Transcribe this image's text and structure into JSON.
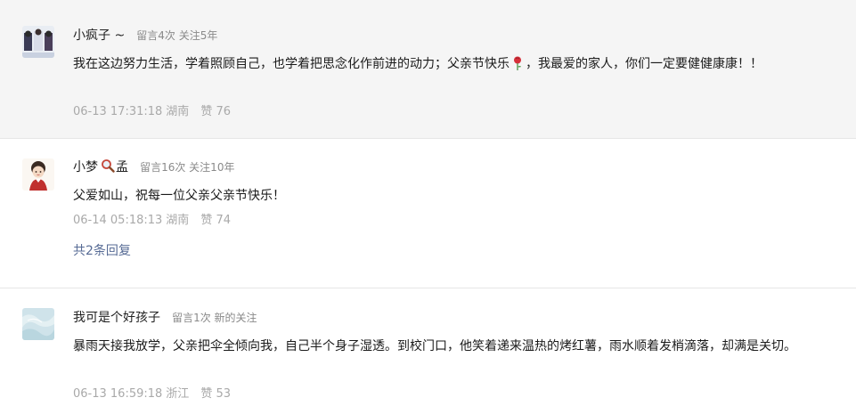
{
  "comments": [
    {
      "nickname": "小疯子 ~",
      "stats": "留言4次 关注5年",
      "content_a": "我在这边努力生活，学着照顾自己，也学着把思念化作前进的动力；父亲节快乐",
      "content_emoji": "rose-emoji",
      "content_b": "，我最爱的家人，你们一定要健健康康！！",
      "time": "06-13 17:31:18",
      "location": "湖南",
      "likes": "赞 76"
    },
    {
      "nickname_a": "小梦",
      "nickname_icon": "magnifier-emoji",
      "nickname_b": "孟",
      "stats": "留言16次 关注10年",
      "content": "父爱如山，祝每一位父亲父亲节快乐！",
      "time": "06-14 05:18:13",
      "location": "湖南",
      "likes": "赞 74",
      "replies_link": "共2条回复"
    },
    {
      "nickname": "我可是个好孩子",
      "stats": "留言1次 新的关注",
      "content": "暴雨天接我放学，父亲把伞全倾向我，自己半个身子湿透。到校门口，他笑着递来温热的烤红薯，雨水顺着发梢滴落，却满是关切。",
      "time": "06-13 16:59:18",
      "location": "浙江",
      "likes": "赞 53"
    }
  ],
  "colors": {
    "highlight_bg": "#f5f5f5",
    "link": "#576b95",
    "meta_text": "#8a8a8a",
    "foot_text": "#a9a9a9"
  }
}
